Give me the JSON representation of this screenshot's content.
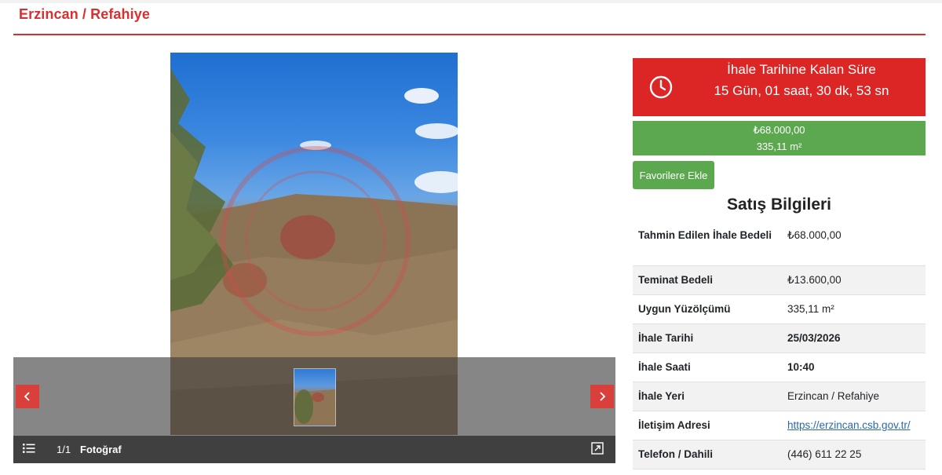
{
  "page": {
    "title": "Erzincan / Refahiye"
  },
  "gallery": {
    "counter": "1/1",
    "photo_label": "Fotoğraf",
    "prev_icon": "chevron-left-icon",
    "next_icon": "chevron-right-icon",
    "list_icon": "list-icon",
    "fullscreen_icon": "fullscreen-icon"
  },
  "countdown": {
    "title": "İhale Tarihine Kalan Süre",
    "value": "15 Gün, 01 saat, 30 dk, 53 sn",
    "icon": "clock-icon",
    "color": "#dc2626"
  },
  "price": {
    "amount": "₺68.000,00",
    "area": "335,11 m²",
    "color": "#5ba84f"
  },
  "favorites_button": {
    "label": "Favorilere Ekle"
  },
  "sales_info": {
    "title": "Satış Bilgileri",
    "rows": [
      {
        "label": "Tahmin Edilen İhale Bedeli",
        "value": "₺68.000,00"
      },
      {
        "label": "Teminat Bedeli",
        "value": "₺13.600,00"
      },
      {
        "label": "Uygun Yüzölçümü",
        "value": "335,11 m²"
      },
      {
        "label": "İhale Tarihi",
        "value": "25/03/2026"
      },
      {
        "label": "İhale Saati",
        "value": "10:40"
      },
      {
        "label": "İhale Yeri",
        "value": "Erzincan / Refahiye"
      },
      {
        "label": "İletişim Adresi",
        "value": "https://erzincan.csb.gov.tr/"
      },
      {
        "label": "Telefon / Dahili",
        "value": "(446) 611 22 25"
      }
    ]
  }
}
